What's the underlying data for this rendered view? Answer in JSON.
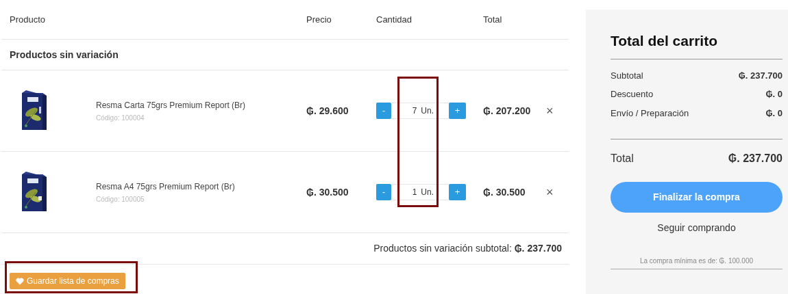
{
  "table": {
    "columns": [
      "Producto",
      "Precio",
      "Cantidad",
      "Total"
    ],
    "section": "Productos sin variación",
    "rows": [
      {
        "kind": "picture",
        "name": "Resma Carta 75grs Premium Report (Br)",
        "code": "Código: 100004",
        "price": "₲. 29.600",
        "quantity": "7",
        "unit": "Un.",
        "total": "₲. 207.200",
        "minus": "-",
        "plus": "+",
        "remove": "×"
      },
      {
        "kind": "picture",
        "name": "Resma A4 75grs Premium Report (Br)",
        "code": "Código: 100005",
        "price": "₲. 30.500",
        "quantity": "1",
        "unit": "Un.",
        "total": "₲. 30.500",
        "minus": "-",
        "plus": "+",
        "remove": "×"
      }
    ],
    "subtotal": "Productos sin variación subtotal: **₲. 237.700**"
  },
  "save_button": "Guardar lista de compras",
  "highlights": {
    "quantity_column": true,
    "save_button": true
  },
  "cart_totals": {
    "title": "Total del carrito",
    "lines": [
      {
        "label": "Subtotal",
        "value": "₲. 237.700"
      },
      {
        "label": "Descuento",
        "value": "₲. 0"
      },
      {
        "label": "Envío / Preparación",
        "value": "₲. 0"
      }
    ],
    "total_label": "Total",
    "total_value": "₲. 237.700",
    "checkout_button": "Finalizar la compra",
    "continue_link": "Seguir comprando",
    "minimum_note": "La compra mínima es de: ₲. 100.000"
  }
}
